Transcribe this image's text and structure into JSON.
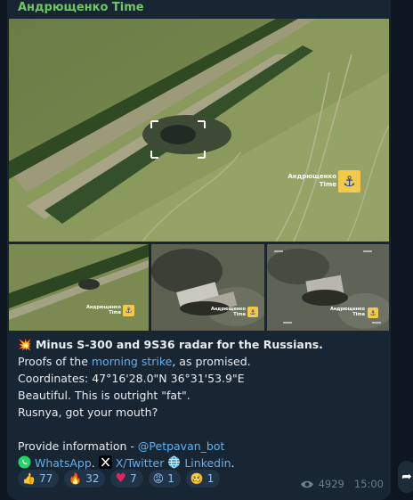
{
  "channel": {
    "name": "Андрющенко Time"
  },
  "watermark": {
    "line1": "Андрющенко",
    "line2": "Time",
    "badge_icon": "anchor-icon"
  },
  "post": {
    "title_emoji": "💥",
    "title": "Minus S-300 and 9S36 radar for the Russians.",
    "line2_pre": "Proofs of the ",
    "line2_link": "morning strike",
    "line2_post": ", as promised.",
    "coordinates": "Coordinates: 47°16'28.0\"N 36°31'53.9\"E",
    "line4": "Beautiful. This is outright \"fat\".",
    "line5": "Rusnya, got your mouth?",
    "provide_info_label": "Provide information - ",
    "provide_info_link": "@Petpavan_bot",
    "links": {
      "whatsapp": "WhatsApp",
      "x": "X/Twitter",
      "linkedin": "Linkedin"
    }
  },
  "reactions": [
    {
      "icon": "thumbs-up-icon",
      "glyph": "👍",
      "count": "77"
    },
    {
      "icon": "fire-icon",
      "glyph": "🔥",
      "count": "32"
    },
    {
      "icon": "heart-icon",
      "glyph": "♥",
      "count": "7"
    },
    {
      "icon": "angry-face-icon",
      "glyph": "😡",
      "count": "1"
    },
    {
      "icon": "woozy-face-icon",
      "glyph": "🥴",
      "count": "1"
    }
  ],
  "meta": {
    "views": "4929",
    "time": "15:00",
    "eye_icon": "eye-icon"
  },
  "colors": {
    "bubble": "#182533",
    "link": "#62b0ee",
    "channel_name": "#6fc95f",
    "badge": "#f2c94c"
  }
}
